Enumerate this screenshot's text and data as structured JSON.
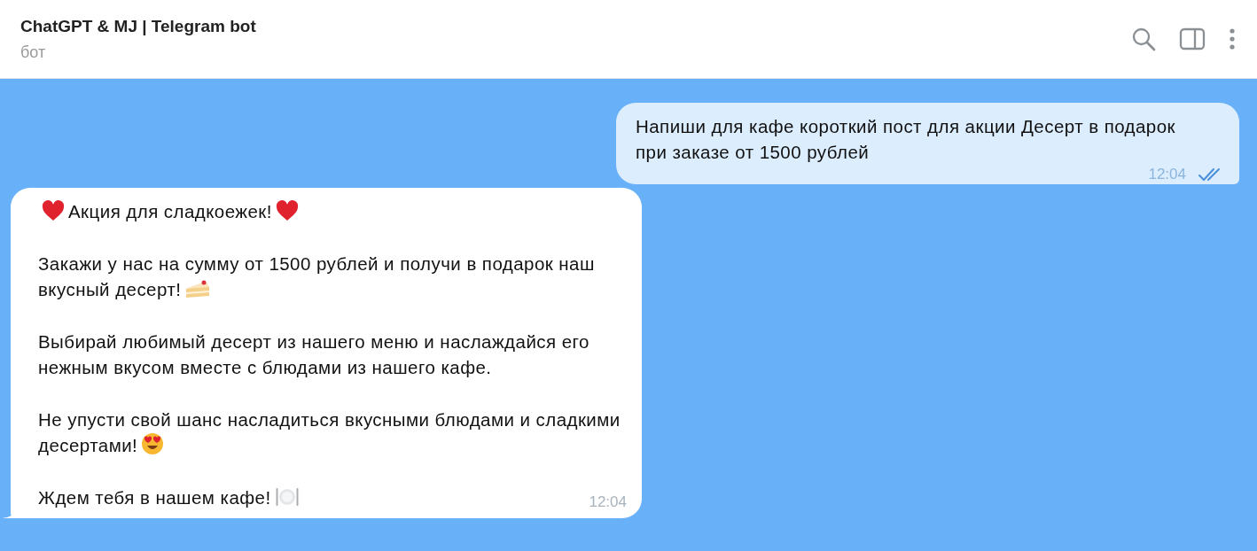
{
  "header": {
    "title": "ChatGPT & MJ | Telegram bot",
    "subtitle": "бот"
  },
  "messages": [
    {
      "kind": "outgoing",
      "time": "12:04",
      "read": true,
      "paragraphs": [
        {
          "text": "Напиши для кафе короткий пост для акции Десерт в подарок при заказе от 1500 рублей"
        }
      ]
    },
    {
      "kind": "incoming",
      "time": "12:04",
      "paragraphs": [
        {
          "text": "Акция для сладкоежек!",
          "lead": {
            "kind": "heart"
          },
          "trail": {
            "kind": "heart"
          }
        },
        {
          "text": "Закажи у нас на сумму от 1500 рублей и получи в подарок наш вкусный десерт!",
          "trail": {
            "kind": "cake"
          }
        },
        {
          "text": "Выбирай любимый десерт из нашего меню и наслаждайся его нежным вкусом вместе с блюдами из нашего кафе."
        },
        {
          "text": "Не упусти свой шанс насладиться вкусными блюдами и сладкими десертами!",
          "trail": {
            "kind": "heart-eyes"
          }
        },
        {
          "text": "Ждем тебя в нашем кафе!",
          "trail": {
            "kind": "plate"
          }
        }
      ]
    }
  ]
}
